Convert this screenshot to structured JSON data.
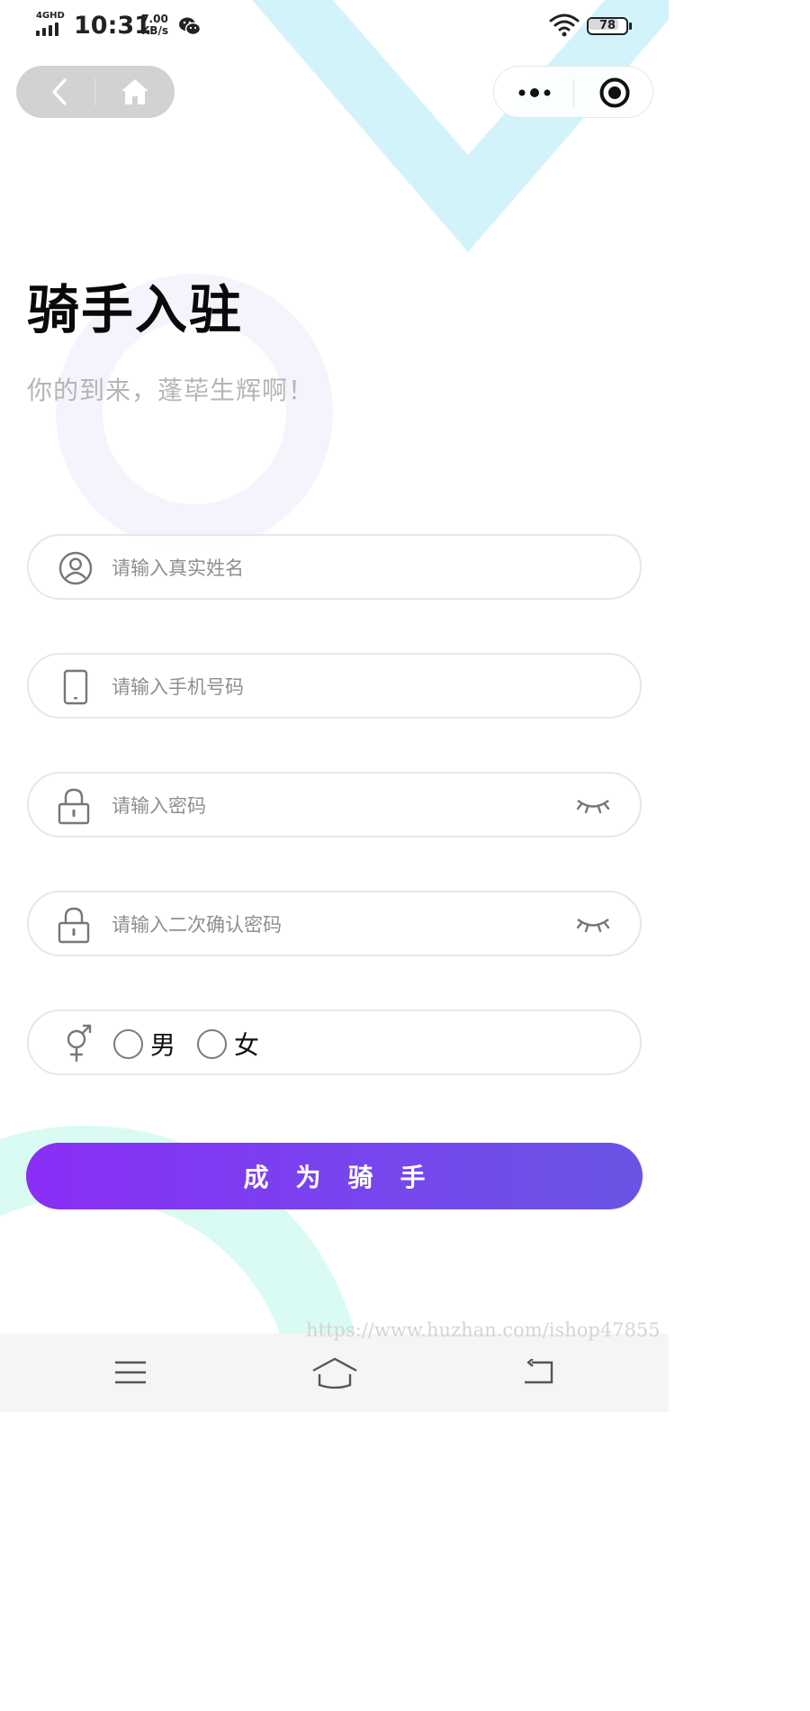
{
  "status_bar": {
    "network": "4GHD",
    "time": "10:31",
    "speed_value": "7.00",
    "speed_unit": "KB/s",
    "battery": "78",
    "battery_level": 0.78
  },
  "nav": {
    "back_icon": "chevron-left-icon",
    "home_icon": "home-icon",
    "more_icon": "more-dots-icon",
    "close_icon": "target-close-icon"
  },
  "page": {
    "title": "骑手入驻",
    "subtitle": "你的到来，蓬荜生辉啊！"
  },
  "form": {
    "name": {
      "placeholder": "请输入真实姓名",
      "value": "",
      "icon": "user-icon"
    },
    "phone": {
      "placeholder": "请输入手机号码",
      "value": "",
      "icon": "phone-icon"
    },
    "password": {
      "placeholder": "请输入密码",
      "value": "",
      "icon": "lock-icon",
      "toggle_icon": "eye-closed-icon"
    },
    "confirm_password": {
      "placeholder": "请输入二次确认密码",
      "value": "",
      "icon": "lock-icon",
      "toggle_icon": "eye-closed-icon"
    },
    "gender": {
      "icon": "gender-icon",
      "options": [
        {
          "label": "男",
          "selected": false
        },
        {
          "label": "女",
          "selected": false
        }
      ]
    },
    "submit_label": "成为骑手"
  },
  "watermark": "https://www.huzhan.com/ishop47855",
  "system_nav": {
    "menu_icon": "menu-icon",
    "home_icon": "home-outline-icon",
    "back_icon": "back-arrow-icon"
  },
  "colors": {
    "accent_start": "#8a2ef6",
    "accent_end": "#6a54e4",
    "decor_blue": "#d3f3fb",
    "decor_mint": "#d8fbf3",
    "decor_lavender": "#f6f3fd"
  }
}
